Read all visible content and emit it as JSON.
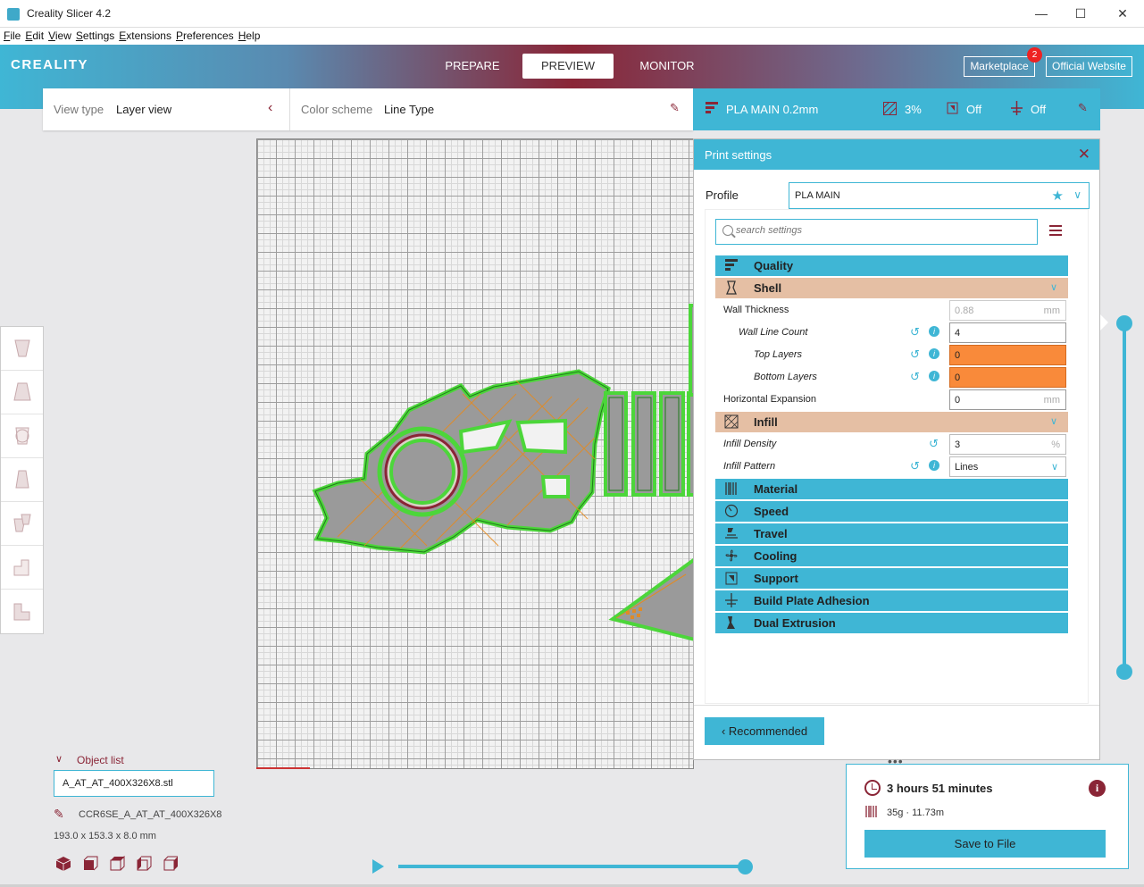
{
  "window": {
    "title": "Creality Slicer 4.2",
    "minimize": "—",
    "maximize": "☐",
    "close": "✕"
  },
  "menu": [
    "File",
    "Edit",
    "View",
    "Settings",
    "Extensions",
    "Preferences",
    "Help"
  ],
  "header": {
    "logo": "CREALITY",
    "tabs": [
      {
        "label": "PREPARE",
        "active": false
      },
      {
        "label": "PREVIEW",
        "active": true
      },
      {
        "label": "MONITOR",
        "active": false
      }
    ],
    "marketplace": "Marketplace",
    "marketplace_badge": "2",
    "official_website": "Official Website"
  },
  "viewbar": {
    "view_type_label": "View type",
    "view_type_value": "Layer view",
    "color_scheme_label": "Color scheme",
    "color_scheme_value": "Line Type"
  },
  "profilebar": {
    "profile": "PLA MAIN 0.2mm",
    "infill": "3%",
    "support": "Off",
    "adhesion": "Off"
  },
  "print_settings": {
    "title": "Print settings",
    "profile_label": "Profile",
    "profile_value": "PLA MAIN",
    "search_placeholder": "search settings",
    "categories": {
      "quality": "Quality",
      "shell": "Shell",
      "infill": "Infill",
      "material": "Material",
      "speed": "Speed",
      "travel": "Travel",
      "cooling": "Cooling",
      "support": "Support",
      "adhesion": "Build Plate Adhesion",
      "dual": "Dual Extrusion"
    },
    "shell_settings": {
      "wall_thickness_label": "Wall Thickness",
      "wall_thickness_value": "0.88",
      "wall_line_count_label": "Wall Line Count",
      "wall_line_count_value": "4",
      "top_layers_label": "Top Layers",
      "top_layers_value": "0",
      "bottom_layers_label": "Bottom Layers",
      "bottom_layers_value": "0",
      "horizontal_expansion_label": "Horizontal Expansion",
      "horizontal_expansion_value": "0",
      "unit_mm": "mm"
    },
    "infill_settings": {
      "density_label": "Infill Density",
      "density_value": "3",
      "density_unit": "%",
      "pattern_label": "Infill Pattern",
      "pattern_value": "Lines"
    },
    "recommended_button": "Recommended"
  },
  "object_list": {
    "header": "Object list",
    "file": "A_AT_AT_400X326X8.stl",
    "object_name": "CCR6SE_A_AT_AT_400X326X8",
    "dimensions": "193.0 x 153.3 x 8.0 mm"
  },
  "estimate": {
    "time": "3 hours 51 minutes",
    "material": "35g · 11.73m",
    "save_button": "Save to File"
  },
  "colors": {
    "accent": "#3fb6d5",
    "brand_red": "#8a2536",
    "category_open": "#e5bfa4",
    "warning": "#f98a3a"
  }
}
